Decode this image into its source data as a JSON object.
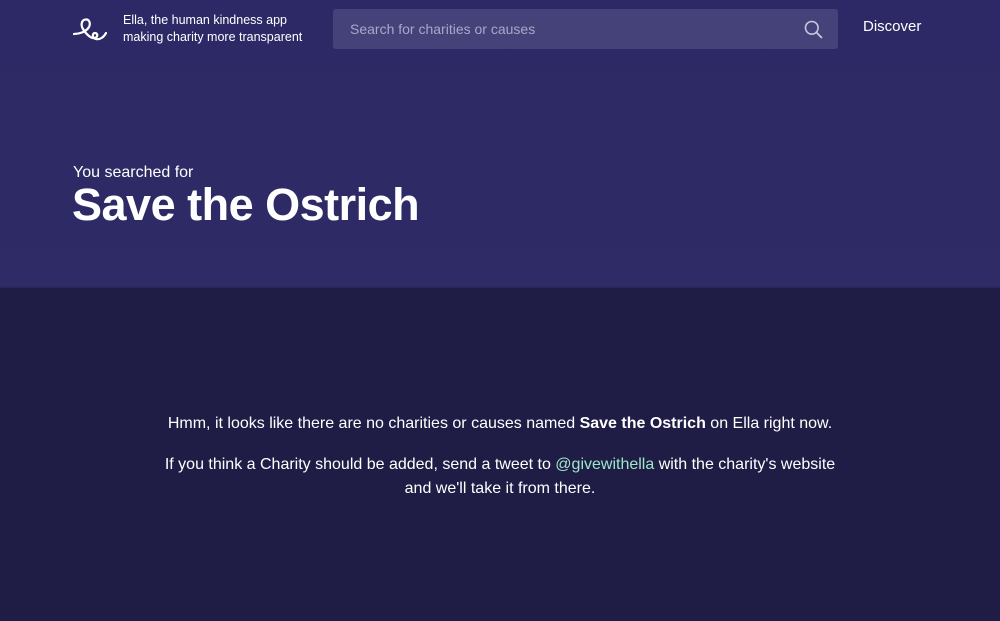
{
  "header": {
    "tagline_line1": "Ella, the human kindness app",
    "tagline_line2": "making charity more transparent",
    "search_placeholder": "Search for charities or causes",
    "search_value": "",
    "nav_discover": "Discover"
  },
  "hero": {
    "label": "You searched for",
    "query": "Save the Ostrich"
  },
  "message": {
    "line1_before": "Hmm, it looks like there are no charities or causes named ",
    "line1_query": "Save the Ostrich",
    "line1_after": " on Ella right now.",
    "line2_before": "If you think a Charity should be added, send a tweet to ",
    "line2_handle": "@givewithella",
    "line2_after": " with the charity's website and we'll take it from there."
  },
  "colors": {
    "hero_bg": "#2d2966",
    "main_bg": "#1f1d45",
    "search_bg": "#45427a",
    "link_accent": "#9fe6c9"
  },
  "icons": {
    "logo": "ella-logo-icon",
    "search": "search-icon"
  }
}
